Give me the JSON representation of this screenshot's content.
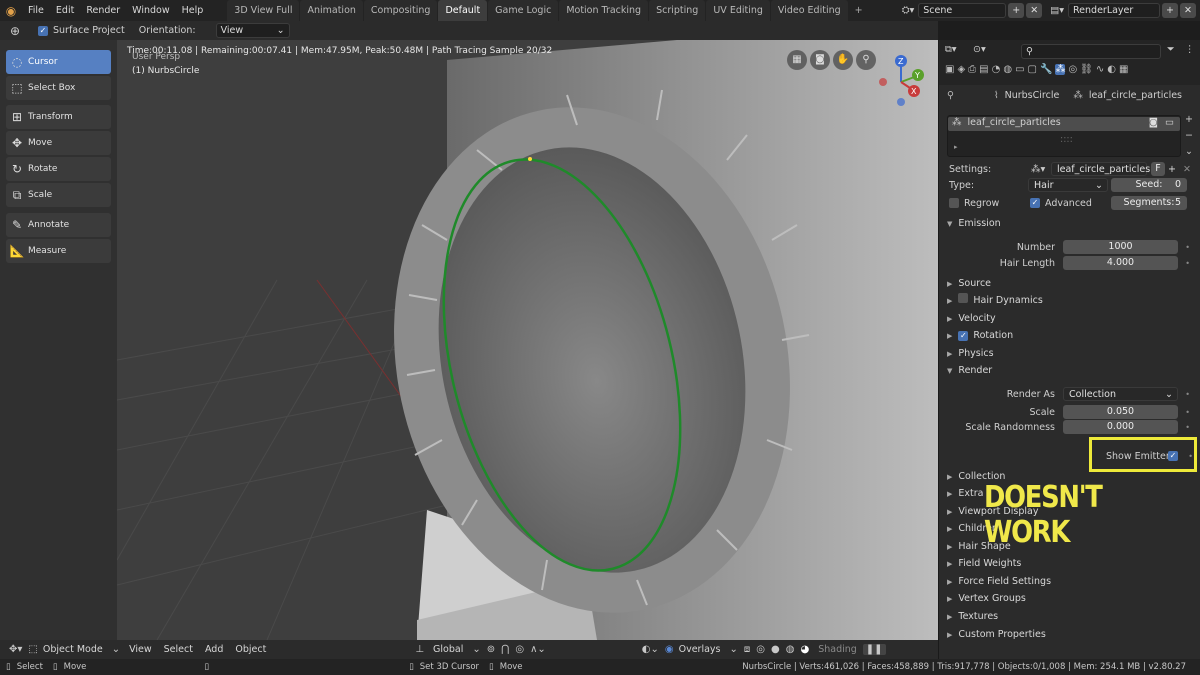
{
  "menu": {
    "items": [
      "File",
      "Edit",
      "Render",
      "Window",
      "Help"
    ]
  },
  "workspace_tabs": [
    "3D View Full",
    "Animation",
    "Compositing",
    "Default",
    "Game Logic",
    "Motion Tracking",
    "Scripting",
    "UV Editing",
    "Video Editing"
  ],
  "active_tab": "Default",
  "scene": {
    "name": "Scene",
    "view_layer": "RenderLayer"
  },
  "tool_header": {
    "surface_project_label": "Surface Project",
    "orientation_label": "Orientation:",
    "orientation_value": "View"
  },
  "toolbar": {
    "cursor": "Cursor",
    "select_box": "Select Box",
    "transform": "Transform",
    "move": "Move",
    "rotate": "Rotate",
    "scale": "Scale",
    "annotate": "Annotate",
    "measure": "Measure"
  },
  "viewport": {
    "render_info": "Time:00:11.08 | Remaining:00:07.41 | Mem:47.95M, Peak:50.48M | Path Tracing Sample 20/32",
    "view_name": "User Persp",
    "object_name": "(1) NurbsCircle",
    "gizmo": {
      "z": "Z",
      "y": "Y",
      "x": "X"
    }
  },
  "viewport_footer": {
    "mode": "Object Mode",
    "view": "View",
    "select": "Select",
    "add": "Add",
    "object": "Object",
    "transform_orientation": "Global",
    "overlays": "Overlays",
    "shading": "Shading"
  },
  "statusbar": {
    "select": "Select",
    "move": "Move",
    "set_cursor": "Set 3D Cursor",
    "move2": "Move",
    "stats": "NurbsCircle | Verts:461,026 | Faces:458,889 | Tris:917,778 | Objects:0/1,008 | Mem: 254.1 MB | v2.80.27"
  },
  "properties": {
    "breadcrumb_object": "NurbsCircle",
    "breadcrumb_system": "leaf_circle_particles",
    "list_item": "leaf_circle_particles",
    "settings_label": "Settings:",
    "settings_value": "leaf_circle_particles",
    "fake_user": "F",
    "type_label": "Type:",
    "type_value": "Hair",
    "seed_label": "Seed:",
    "seed_value": "0",
    "regrow_label": "Regrow",
    "advanced_label": "Advanced",
    "segments_label": "Segments:",
    "segments_value": "5",
    "emission": {
      "title": "Emission",
      "number_label": "Number",
      "number_value": "1000",
      "hair_length_label": "Hair Length",
      "hair_length_value": "4.000"
    },
    "source": "Source",
    "hair_dynamics": "Hair Dynamics",
    "velocity": "Velocity",
    "rotation": "Rotation",
    "physics": "Physics",
    "render": {
      "title": "Render",
      "render_as_label": "Render As",
      "render_as_value": "Collection",
      "scale_label": "Scale",
      "scale_value": "0.050",
      "scale_rand_label": "Scale Randomness",
      "scale_rand_value": "0.000",
      "show_emitter_label": "Show Emitter"
    },
    "collection": "Collection",
    "extra": "Extra",
    "viewport_display": "Viewport Display",
    "children": "Children",
    "hair_shape": "Hair Shape",
    "field_weights": "Field Weights",
    "force_field_settings": "Force Field Settings",
    "vertex_groups": "Vertex Groups",
    "textures": "Textures",
    "custom_properties": "Custom Properties"
  },
  "annotation": {
    "text": "DOESN'T WORK",
    "color": "#eeea3a"
  },
  "colors": {
    "accent": "#4772b3",
    "active_tool": "#5680c2",
    "blender_orange": "#e2a14a"
  }
}
